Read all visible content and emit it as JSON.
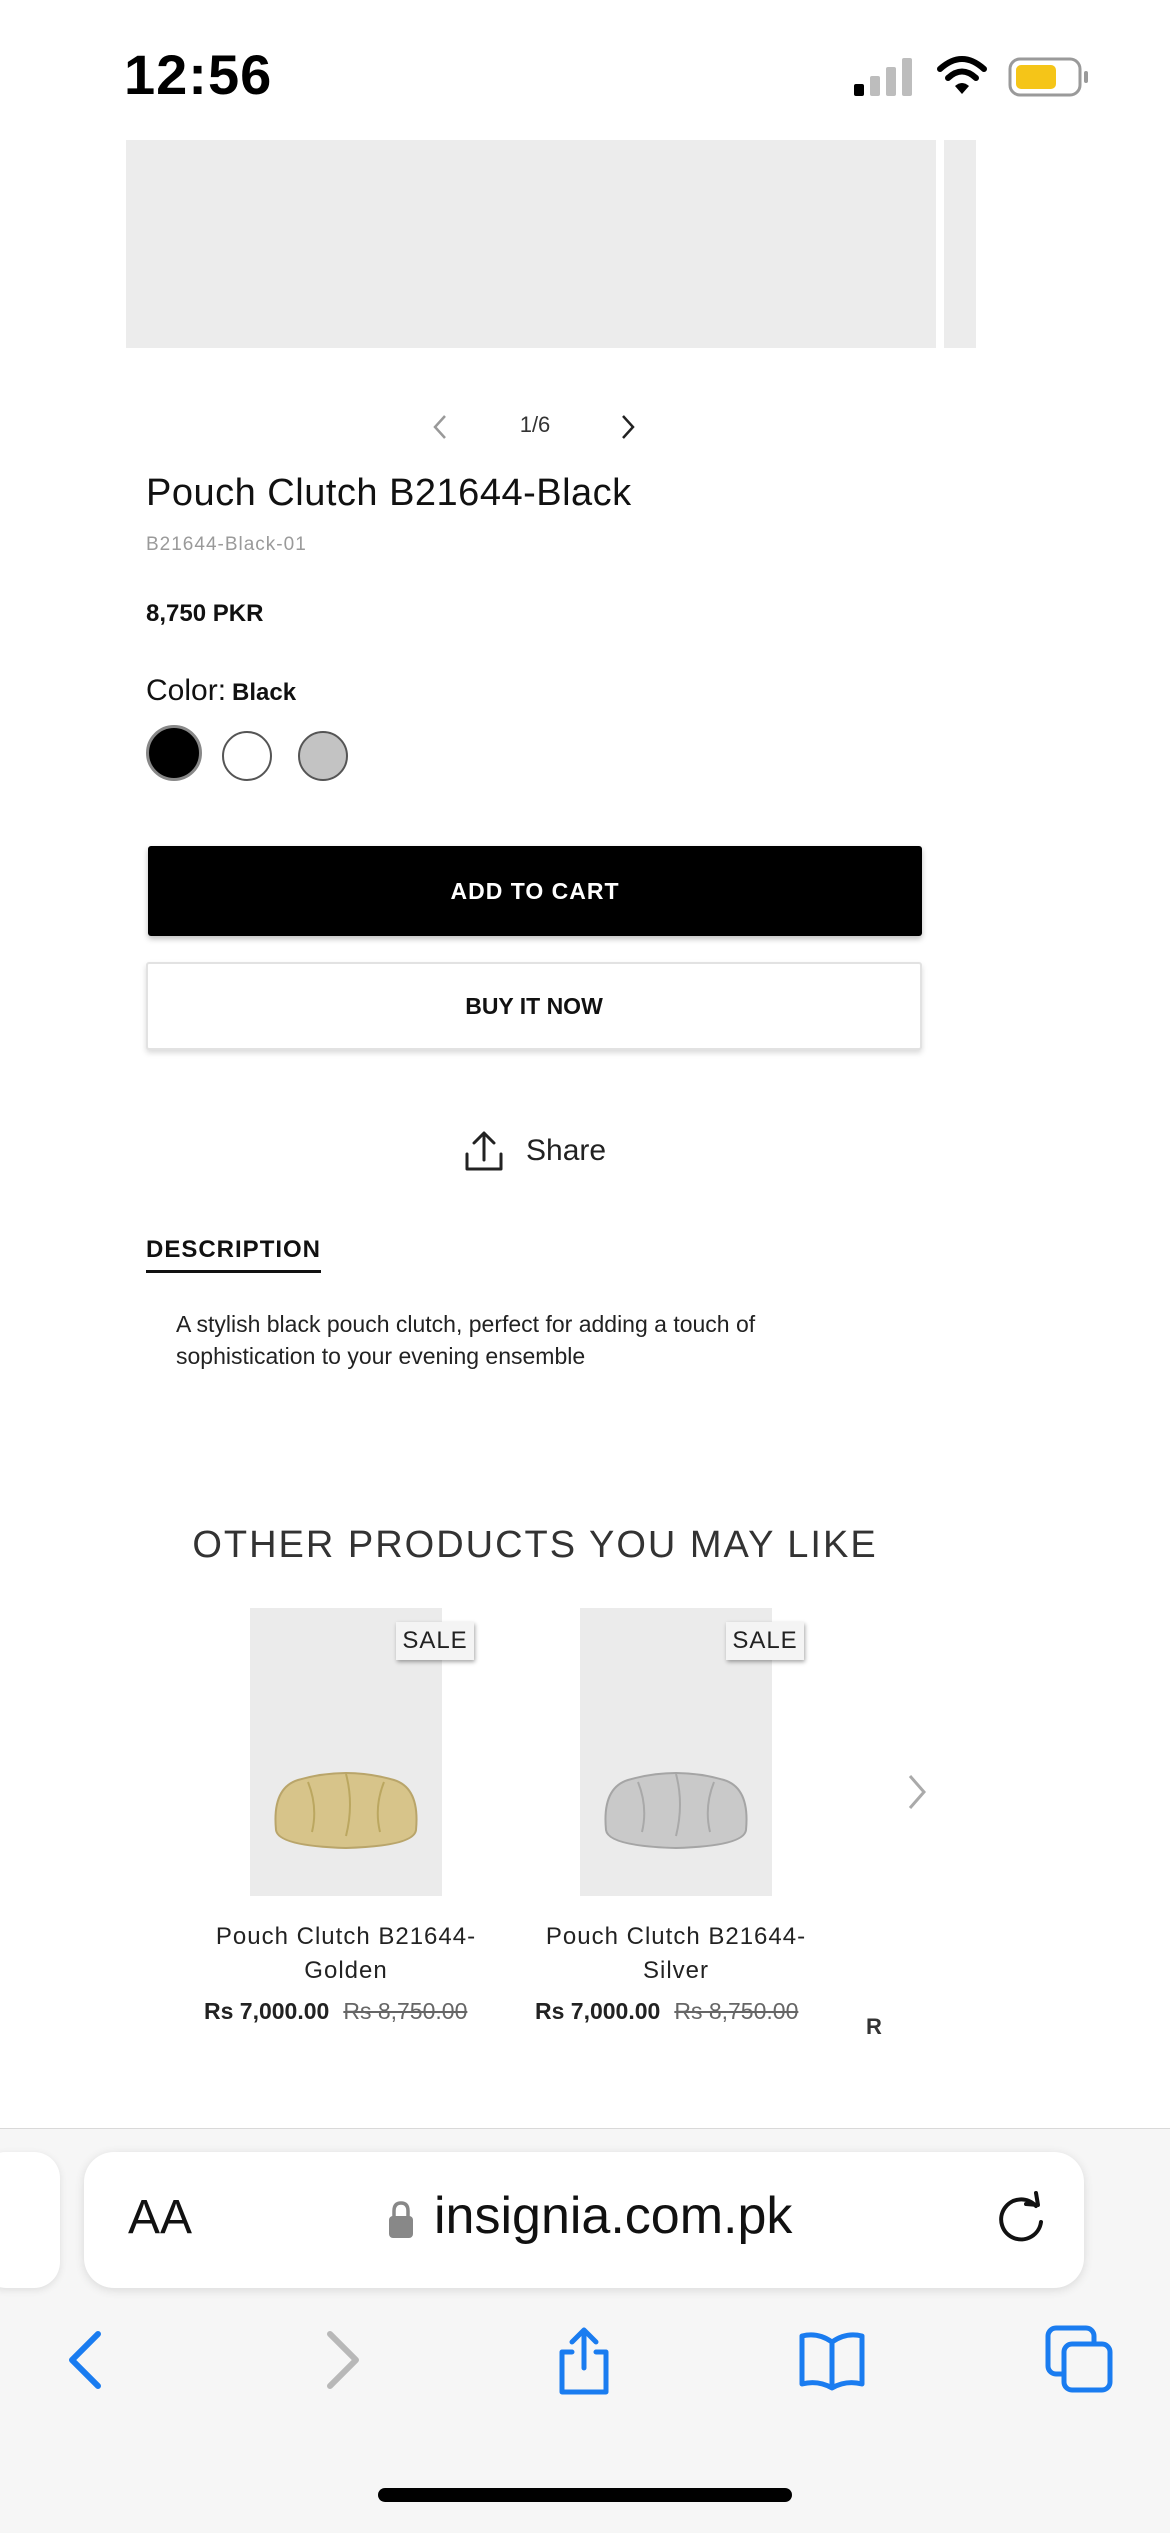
{
  "status_bar": {
    "time": "12:56"
  },
  "gallery": {
    "pager": "1/6"
  },
  "product": {
    "title": "Pouch Clutch B21644-Black",
    "sku": "B21644-Black-01",
    "price": "8,750 PKR",
    "color_label": "Color:",
    "color_value": "Black",
    "add_to_cart": "ADD TO CART",
    "buy_now": "BUY IT NOW",
    "share": "Share",
    "description_tab": "DESCRIPTION",
    "description": "A stylish black pouch clutch, perfect for adding a touch of sophistication to your evening ensemble"
  },
  "related": {
    "title": "OTHER PRODUCTS YOU MAY LIKE",
    "items": [
      {
        "badge": "SALE",
        "name": "Pouch Clutch B21644-Golden",
        "price": "Rs 7,000.00",
        "compare_price": "Rs 8,750.00"
      },
      {
        "badge": "SALE",
        "name": "Pouch Clutch B21644-Silver",
        "price": "Rs 7,000.00",
        "compare_price": "Rs 8,750.00"
      }
    ],
    "peek_text": "R"
  },
  "browser": {
    "text_size": "AA",
    "url": "insignia.com.pk"
  },
  "colors": {
    "accent": "#1a7cf0",
    "swatch_black": "#000000",
    "swatch_white": "#ffffff",
    "swatch_gray": "#c3c3c3",
    "golden": "#d7c48a",
    "silver": "#c9c9c9"
  }
}
